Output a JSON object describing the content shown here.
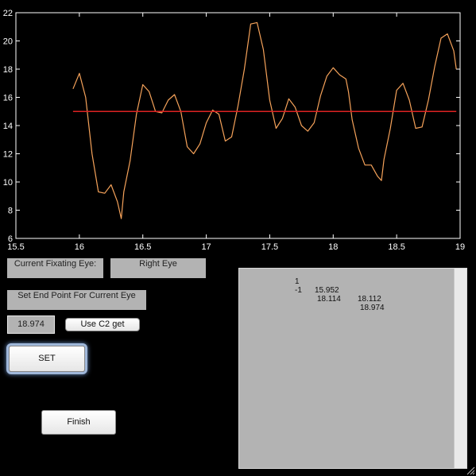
{
  "chart_data": {
    "type": "line",
    "xlim": [
      15.5,
      19
    ],
    "ylim": [
      6,
      22
    ],
    "x_ticks": [
      "15.5",
      "16",
      "16.5",
      "17",
      "17.5",
      "18",
      "18.5",
      "19"
    ],
    "y_ticks": [
      "6",
      "8",
      "10",
      "12",
      "14",
      "16",
      "18",
      "20",
      "22"
    ],
    "grid": false,
    "series": [
      {
        "color": "#f5a25a",
        "x": [
          15.95,
          16.0,
          16.05,
          16.1,
          16.15,
          16.2,
          16.25,
          16.3,
          16.33,
          16.35,
          16.4,
          16.45,
          16.5,
          16.55,
          16.6,
          16.65,
          16.7,
          16.75,
          16.8,
          16.85,
          16.9,
          16.95,
          17.0,
          17.05,
          17.1,
          17.15,
          17.2,
          17.25,
          17.3,
          17.35,
          17.4,
          17.45,
          17.5,
          17.55,
          17.6,
          17.65,
          17.7,
          17.75,
          17.8,
          17.85,
          17.9,
          17.95,
          18.0,
          18.05,
          18.1,
          18.12,
          18.15,
          18.2,
          18.25,
          18.3,
          18.35,
          18.38,
          18.4,
          18.45,
          18.5,
          18.55,
          18.6,
          18.65,
          18.7,
          18.75,
          18.8,
          18.85,
          18.9,
          18.95,
          18.97
        ],
        "y": [
          16.6,
          17.7,
          16.0,
          12.0,
          9.3,
          9.2,
          9.8,
          8.6,
          7.4,
          9.3,
          11.5,
          14.8,
          16.9,
          16.4,
          15.0,
          14.9,
          15.8,
          16.2,
          15.0,
          12.5,
          12.0,
          12.7,
          14.2,
          15.1,
          14.8,
          12.9,
          13.2,
          15.4,
          18.0,
          21.2,
          21.3,
          19.4,
          15.8,
          13.8,
          14.5,
          15.9,
          15.3,
          14.0,
          13.6,
          14.2,
          16.1,
          17.5,
          18.1,
          17.6,
          17.3,
          16.4,
          14.4,
          12.4,
          11.2,
          11.2,
          10.4,
          10.1,
          11.6,
          13.8,
          16.5,
          17.0,
          15.8,
          13.8,
          13.9,
          15.8,
          18.2,
          20.2,
          20.5,
          19.3,
          18.0
        ]
      },
      {
        "color": "#dd2222",
        "x": [
          15.95,
          18.97
        ],
        "y": [
          15.0,
          15.0
        ]
      }
    ]
  },
  "controls": {
    "fixating_eye_label": "Current Fixating Eye:",
    "fixating_eye_value": "Right Eye",
    "end_point_label": "Set End Point For Current Eye",
    "end_point_value": "18.974",
    "use_c2_label": "Use C2 get",
    "set_label": "SET",
    "finish_label": "Finish"
  },
  "table": {
    "rows": [
      [
        "1",
        "15.952",
        "18.112"
      ],
      [
        "-1",
        "18.114",
        "18.974"
      ]
    ]
  }
}
